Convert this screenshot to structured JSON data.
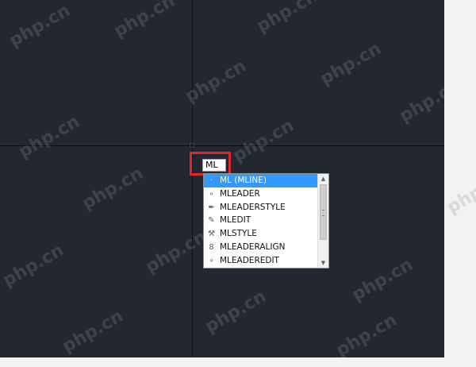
{
  "command_line": {
    "value": "ML"
  },
  "autocomplete": {
    "items": [
      {
        "label": "ML (MLINE)",
        "icon": "mline-icon",
        "glyph": "·",
        "selected": true
      },
      {
        "label": "MLEADER",
        "icon": "mleader-icon",
        "glyph": "∘",
        "selected": false
      },
      {
        "label": "MLEADERSTYLE",
        "icon": "mleaderstyle-icon",
        "glyph": "✒",
        "selected": false
      },
      {
        "label": "MLEDIT",
        "icon": "mledit-icon",
        "glyph": "✎",
        "selected": false
      },
      {
        "label": "MLSTYLE",
        "icon": "mlstyle-icon",
        "glyph": "⚒",
        "selected": false
      },
      {
        "label": "MLEADERALIGN",
        "icon": "mleaderalign-icon",
        "glyph": "8",
        "selected": false
      },
      {
        "label": "MLEADEREDIT",
        "icon": "mleaderedit-icon",
        "glyph": "∘",
        "selected": false
      }
    ]
  },
  "scrollbar": {
    "up_glyph": "▲",
    "down_glyph": "▼"
  },
  "watermark": {
    "text": "php.cn"
  },
  "colors": {
    "canvas": "#222730",
    "highlight_box": "#e0262b",
    "selection": "#3399ff"
  }
}
